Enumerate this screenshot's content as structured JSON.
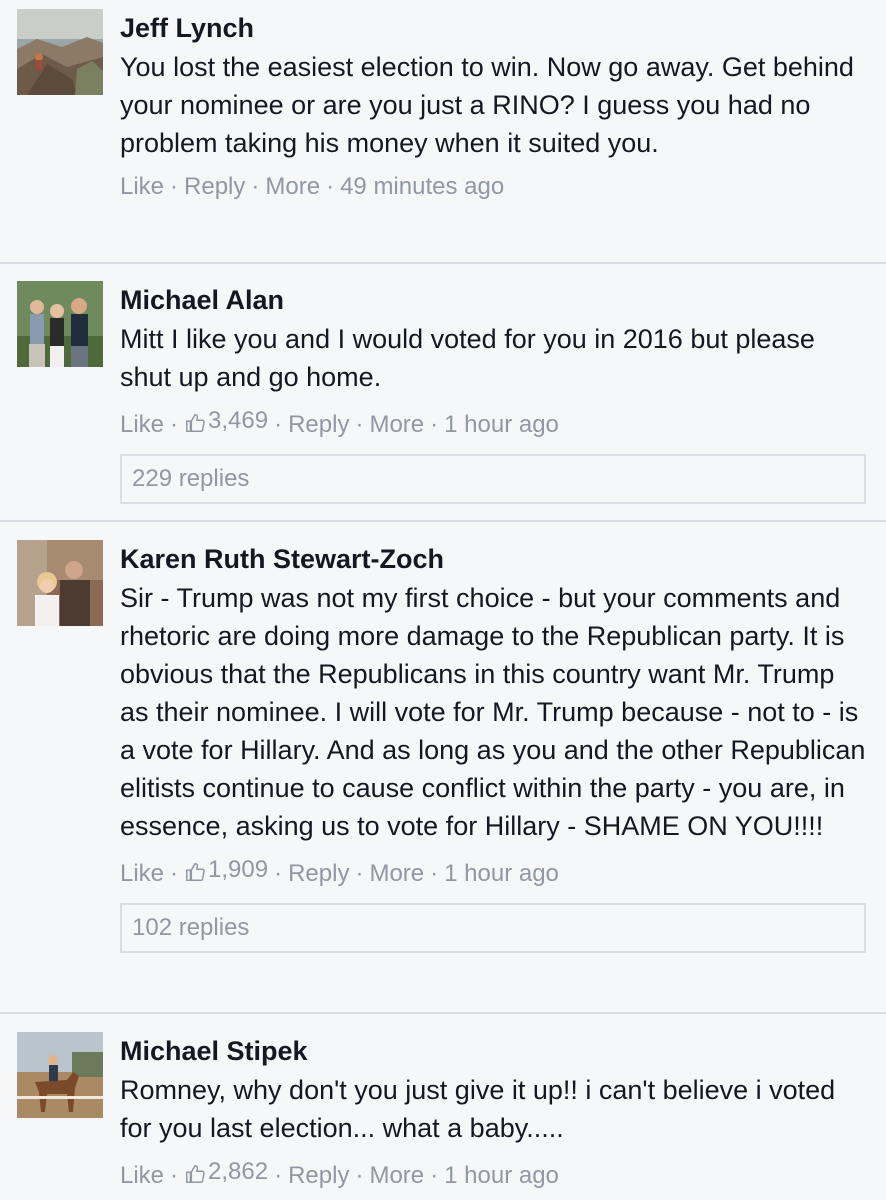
{
  "comments": [
    {
      "author": "Jeff Lynch",
      "text": "You lost the easiest election to win. Now go away. Get behind your nominee or are you just a RINO? I guess you had no problem taking his money when it suited you.",
      "like_label": "Like",
      "reply_label": "Reply",
      "more_label": "More",
      "time": "49 minutes ago",
      "avatar_icon": "landscape-photo"
    },
    {
      "author": "Michael Alan",
      "text": "Mitt I like you and I would voted for you in 2016 but please shut up and go home.",
      "like_label": "Like",
      "like_count": "3,469",
      "reply_label": "Reply",
      "more_label": "More",
      "time": "1 hour ago",
      "replies_label": "229 replies",
      "avatar_icon": "group-photo"
    },
    {
      "author": "Karen Ruth Stewart-Zoch",
      "text": "Sir - Trump was not my first choice - but your comments and rhetoric are doing more damage to the Republican party. It is obvious that the Republicans in this country want Mr. Trump as their nominee. I will vote for Mr. Trump because - not to - is a vote for Hillary. And as long as you and the other Republican elitists continue to cause conflict within the party - you are, in essence, asking us to vote for Hillary - SHAME ON YOU!!!!",
      "like_label": "Like",
      "like_count": "1,909",
      "reply_label": "Reply",
      "more_label": "More",
      "time": "1 hour ago",
      "replies_label": "102 replies",
      "avatar_icon": "couple-photo"
    },
    {
      "author": "Michael Stipek",
      "text": "Romney, why don't you just give it up!! i can't believe i voted for you last election... what a baby.....",
      "like_label": "Like",
      "like_count": "2,862",
      "reply_label": "Reply",
      "more_label": "More",
      "time": "1 hour ago",
      "avatar_icon": "horse-rider-photo"
    }
  ],
  "colors": {
    "background": "#f6f7f9",
    "text": "#141823",
    "meta": "#9197a3",
    "divider": "#d9dbe0"
  }
}
